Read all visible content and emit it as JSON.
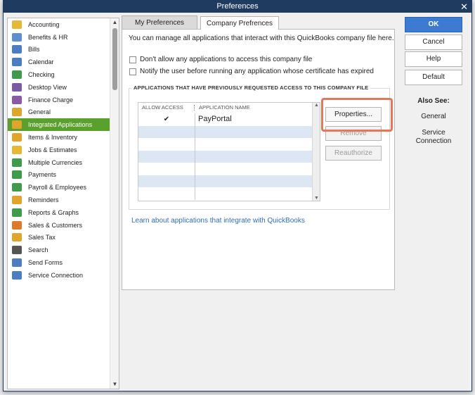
{
  "window": {
    "title": "Preferences"
  },
  "sidebar": {
    "items": [
      {
        "label": "Accounting",
        "icon": "accounting-icon",
        "color": "#e6b935"
      },
      {
        "label": "Benefits & HR",
        "icon": "benefits-hr-icon",
        "color": "#5b8fd0"
      },
      {
        "label": "Bills",
        "icon": "bills-icon",
        "color": "#4a7dc2"
      },
      {
        "label": "Calendar",
        "icon": "calendar-icon",
        "color": "#4a7dc2"
      },
      {
        "label": "Checking",
        "icon": "checking-icon",
        "color": "#3f9a4a"
      },
      {
        "label": "Desktop View",
        "icon": "desktop-view-icon",
        "color": "#7b5aa6"
      },
      {
        "label": "Finance Charge",
        "icon": "finance-charge-icon",
        "color": "#8a5aa6"
      },
      {
        "label": "General",
        "icon": "general-icon",
        "color": "#e0a52a"
      },
      {
        "label": "Integrated Applications",
        "icon": "integrated-applications-icon",
        "color": "#e0a52a"
      },
      {
        "label": "Items & Inventory",
        "icon": "items-inventory-icon",
        "color": "#e0a52a"
      },
      {
        "label": "Jobs & Estimates",
        "icon": "jobs-estimates-icon",
        "color": "#e6b935"
      },
      {
        "label": "Multiple Currencies",
        "icon": "multiple-currencies-icon",
        "color": "#3f9a4a"
      },
      {
        "label": "Payments",
        "icon": "payments-icon",
        "color": "#3f9a4a"
      },
      {
        "label": "Payroll & Employees",
        "icon": "payroll-employees-icon",
        "color": "#3f9a4a"
      },
      {
        "label": "Reminders",
        "icon": "reminders-icon",
        "color": "#e0a52a"
      },
      {
        "label": "Reports & Graphs",
        "icon": "reports-graphs-icon",
        "color": "#3f9a4a"
      },
      {
        "label": "Sales & Customers",
        "icon": "sales-customers-icon",
        "color": "#e07a2a"
      },
      {
        "label": "Sales Tax",
        "icon": "sales-tax-icon",
        "color": "#e0a52a"
      },
      {
        "label": "Search",
        "icon": "search-icon",
        "color": "#555555"
      },
      {
        "label": "Send Forms",
        "icon": "send-forms-icon",
        "color": "#4a7dc2"
      },
      {
        "label": "Service Connection",
        "icon": "service-connection-icon",
        "color": "#4a7dc2"
      }
    ],
    "selected": "Integrated Applications",
    "selected_color": "#5aa02c"
  },
  "tabs": {
    "my_preferences": "My Preferences",
    "company_preferences": "Company Prefrences"
  },
  "company": {
    "intro": "You can manage all applications that interact with this QuickBooks company file here.",
    "checkbox_dont_allow": "Don't allow any applications to access this company file",
    "checkbox_notify": "Notify the user before running any application whose certificate has expired",
    "group_title": "APPLICATIONS THAT HAVE PREVIOUSLY REQUESTED ACCESS TO THIS COMPANY FILE",
    "columns": {
      "allow_access": "ALLOW ACCESS",
      "application_name": "APPLICATION NAME"
    },
    "rows": [
      {
        "allow": "✔",
        "name": "PayPortal"
      }
    ],
    "buttons": {
      "properties": "Properties...",
      "remove": "Remove",
      "reauthorize": "Reauthorize"
    },
    "learn_link": "Learn about applications that integrate with QuickBooks"
  },
  "actions": {
    "ok": "OK",
    "cancel": "Cancel",
    "help": "Help",
    "default": "Default"
  },
  "also_see": {
    "title": "Also See:",
    "links": [
      "General",
      "Service Connection"
    ]
  },
  "colors": {
    "titlebar": "#1f3b60",
    "ok_button": "#3d7bd2",
    "link": "#2f6db4",
    "highlight": "#e6785a"
  }
}
